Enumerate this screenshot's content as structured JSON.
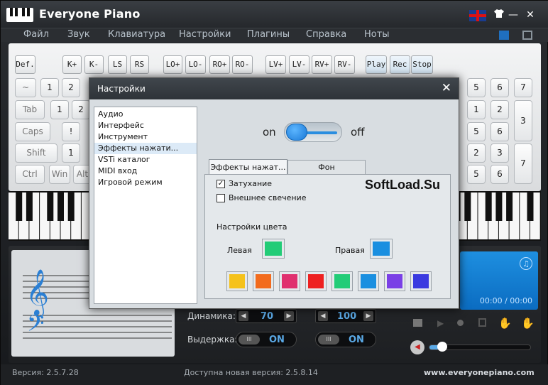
{
  "app": {
    "title": "Everyone Piano"
  },
  "titlebar": {
    "minimize": "—",
    "close": "✕"
  },
  "menu": [
    "Файл",
    "Звук",
    "Клавиатура",
    "Настройки",
    "Плагины",
    "Справка",
    "Ноты"
  ],
  "function_buttons": [
    "Def.",
    "K+",
    "K-",
    "LS",
    "RS",
    "LO+",
    "LO-",
    "RO+",
    "RO-",
    "LV+",
    "LV-",
    "RV+",
    "RV-",
    "Play",
    "Rec",
    "Stop"
  ],
  "keys": {
    "left_row1": [
      "~",
      "1",
      "2"
    ],
    "left_row2": [
      "Tab",
      "1",
      "2"
    ],
    "left_row3": [
      "Caps",
      "!",
      ""
    ],
    "left_row4": [
      "Shift",
      "1",
      ""
    ],
    "left_row5": [
      "Ctrl",
      "Win",
      "Alt"
    ],
    "right_row1": [
      "5",
      "6",
      "7"
    ],
    "right_row2": [
      "1",
      "2",
      "3"
    ],
    "right_row3": [
      "5",
      "6"
    ],
    "right_row4": [
      "2",
      "3",
      "7"
    ],
    "right_row5": [
      "5",
      "6"
    ]
  },
  "controls": {
    "dynamics_label": "Динамика:",
    "dynamics_value": "70",
    "dynamics_right_value": "100",
    "sustain_label": "Выдержка:",
    "sustain_value": "ON",
    "sustain_right_value": "ON",
    "toggle_knob": "III",
    "time": "00:00 / 00:00"
  },
  "status": {
    "version": "Версия: 2.5.7.28",
    "update": "Доступна новая версия: 2.5.8.14",
    "website": "www.everyonepiano.com"
  },
  "dialog": {
    "title": "Настройки",
    "close": "✕",
    "list": [
      "Аудио",
      "Интерфейс",
      "Инструмент",
      "Эффекты нажати...",
      "VSTi каталог",
      "MIDI вход",
      "Игровой режим"
    ],
    "selected_index": 3,
    "toggle_on": "on",
    "toggle_off": "off",
    "tabs": [
      "Эффекты нажат...",
      "Фон"
    ],
    "fade_label": "Затухание",
    "fade_checked": true,
    "glow_label": "Внешнее свечение",
    "glow_checked": false,
    "color_settings": "Настройки цвета",
    "left_label": "Левая",
    "right_label": "Правая",
    "watermark": "SoftLoad.Su",
    "left_color": "#22cc77",
    "right_color": "#1a8fe0",
    "palette": [
      "#f5c21b",
      "#f26b1d",
      "#e0306f",
      "#ee2020",
      "#22cc77",
      "#1a8fe0",
      "#7a3fe6",
      "#3a3ae0"
    ]
  }
}
